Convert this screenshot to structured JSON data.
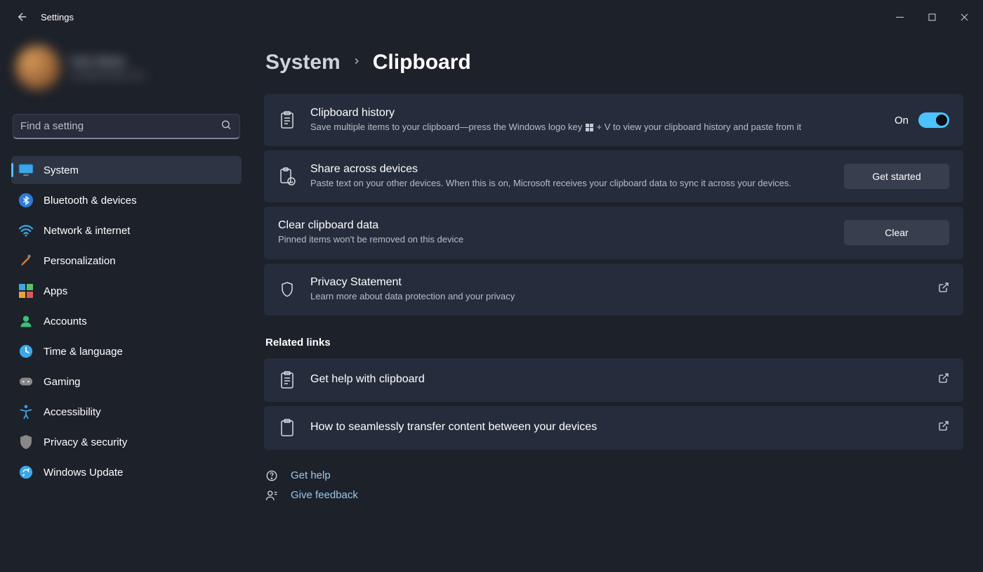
{
  "window": {
    "title": "Settings"
  },
  "profile": {
    "name": "User Name",
    "email": "user@example.com"
  },
  "search": {
    "placeholder": "Find a setting"
  },
  "sidebar": {
    "items": [
      {
        "label": "System",
        "icon": "monitor"
      },
      {
        "label": "Bluetooth & devices",
        "icon": "bluetooth"
      },
      {
        "label": "Network & internet",
        "icon": "wifi"
      },
      {
        "label": "Personalization",
        "icon": "brush"
      },
      {
        "label": "Apps",
        "icon": "apps"
      },
      {
        "label": "Accounts",
        "icon": "person"
      },
      {
        "label": "Time & language",
        "icon": "clock"
      },
      {
        "label": "Gaming",
        "icon": "gamepad"
      },
      {
        "label": "Accessibility",
        "icon": "accessibility"
      },
      {
        "label": "Privacy & security",
        "icon": "shield"
      },
      {
        "label": "Windows Update",
        "icon": "update"
      }
    ]
  },
  "breadcrumb": {
    "parent": "System",
    "current": "Clipboard"
  },
  "cards": {
    "history": {
      "title": "Clipboard history",
      "desc_pre": "Save multiple items to your clipboard—press the Windows logo key ",
      "desc_post": " + V to view your clipboard history and paste from it",
      "toggle_label": "On"
    },
    "share": {
      "title": "Share across devices",
      "desc": "Paste text on your other devices. When this is on, Microsoft receives your clipboard data to sync it across your devices.",
      "button": "Get started"
    },
    "clear": {
      "title": "Clear clipboard data",
      "desc": "Pinned items won't be removed on this device",
      "button": "Clear"
    },
    "privacy": {
      "title": "Privacy Statement",
      "desc": "Learn more about data protection and your privacy"
    }
  },
  "related": {
    "heading": "Related links",
    "help": "Get help with clipboard",
    "transfer": "How to seamlessly transfer content between your devices"
  },
  "footer": {
    "get_help": "Get help",
    "feedback": "Give feedback"
  }
}
